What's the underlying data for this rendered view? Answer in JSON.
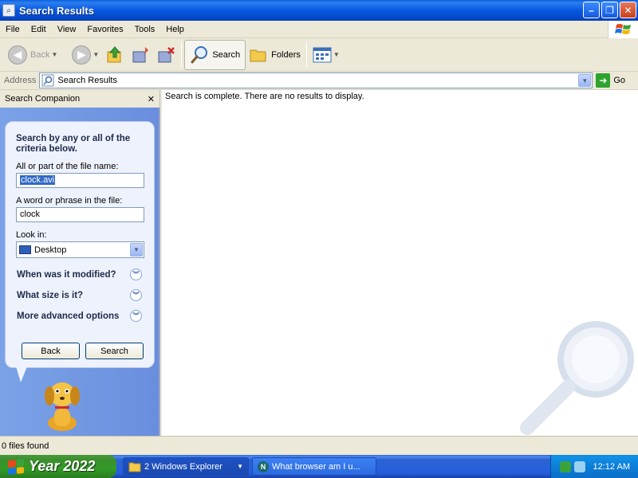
{
  "window": {
    "title": "Search Results"
  },
  "menu": [
    "File",
    "Edit",
    "View",
    "Favorites",
    "Tools",
    "Help"
  ],
  "toolbar": {
    "back": "Back",
    "search": "Search",
    "folders": "Folders"
  },
  "address": {
    "label": "Address",
    "value": "Search Results",
    "go": "Go"
  },
  "companion": {
    "title": "Search Companion",
    "close": "✕",
    "heading": "Search by any or all of the criteria below.",
    "filename_label": "All or part of the file name:",
    "filename_value": "clock.avi",
    "phrase_label": "A word or phrase in the file:",
    "phrase_value": "clock",
    "lookin_label": "Look in:",
    "lookin_value": "Desktop",
    "options": [
      "When was it modified?",
      "What size is it?",
      "More advanced options"
    ],
    "back_button": "Back",
    "search_button": "Search"
  },
  "results": {
    "message": "Search is complete. There are no results to display."
  },
  "status": {
    "text": "0 files found"
  },
  "taskbar": {
    "start": "Year 2022",
    "tasks": [
      "2 Windows Explorer",
      "What browser am I u..."
    ],
    "clock": "12:12 AM"
  },
  "icons": [
    "ie-icon",
    "back-icon",
    "forward-icon",
    "up-folder-icon",
    "move-to-icon",
    "delete-icon",
    "search-icon",
    "folders-icon",
    "views-icon",
    "go-icon",
    "dog-icon",
    "magnifier-icon",
    "windows-flag-icon"
  ]
}
